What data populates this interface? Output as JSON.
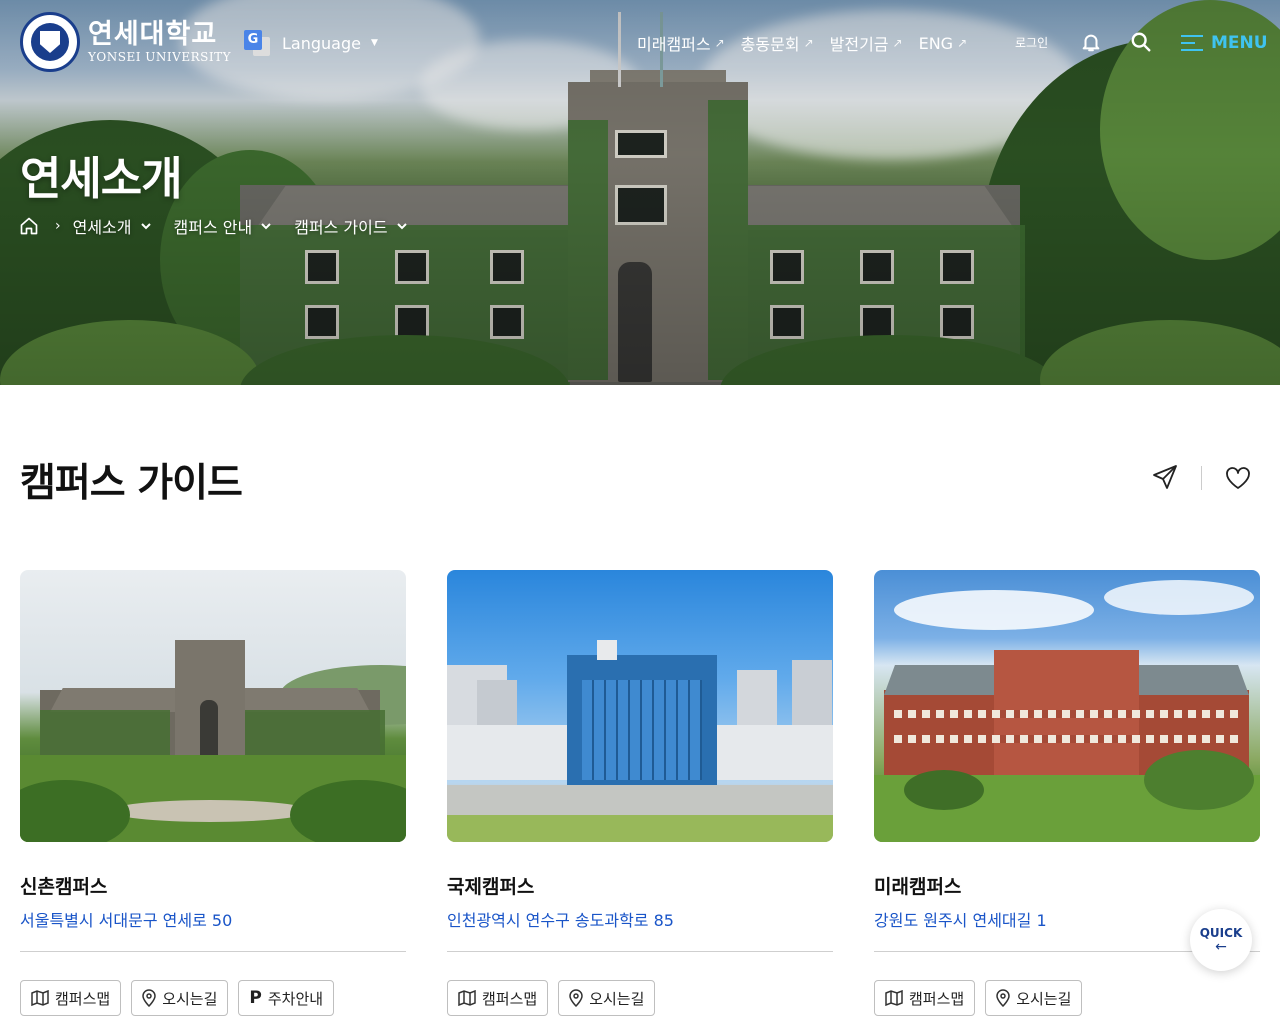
{
  "header": {
    "logo_ko": "연세대학교",
    "logo_en": "YONSEI UNIVERSITY",
    "language_label": "Language",
    "nav": [
      {
        "label": "미래캠퍼스"
      },
      {
        "label": "총동문회"
      },
      {
        "label": "발전기금"
      },
      {
        "label": "ENG"
      }
    ],
    "login_label": "로그인",
    "menu_label": "MENU",
    "accent_color": "#3fc3f0"
  },
  "hero": {
    "title": "연세소개",
    "breadcrumb": [
      "연세소개",
      "캠퍼스 안내",
      "캠퍼스 가이드"
    ]
  },
  "page": {
    "title": "캠퍼스 가이드"
  },
  "cards": [
    {
      "name": "신촌캠퍼스",
      "address": "서울특별시 서대문구 연세로 50",
      "buttons": [
        "캠퍼스맵",
        "오시는길",
        "주차안내"
      ]
    },
    {
      "name": "국제캠퍼스",
      "address": "인천광역시 연수구 송도과학로 85",
      "buttons": [
        "캠퍼스맵",
        "오시는길"
      ]
    },
    {
      "name": "미래캠퍼스",
      "address": "강원도 원주시 연세대길 1",
      "buttons": [
        "캠퍼스맵",
        "오시는길"
      ]
    }
  ],
  "quick": {
    "label": "QUICK",
    "arrow": "←"
  },
  "link_color": "#1a55c8"
}
